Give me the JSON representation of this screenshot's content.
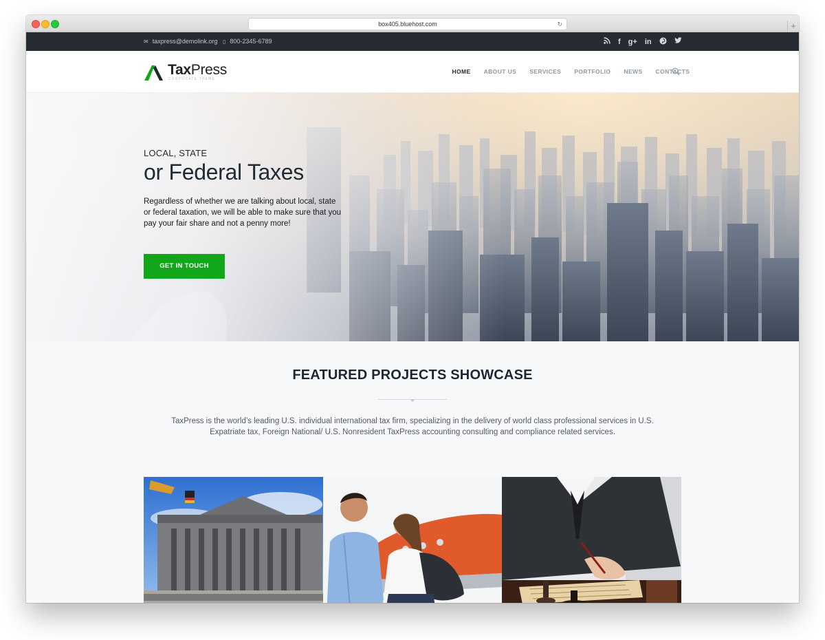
{
  "browser": {
    "url": "box405.bluehost.com"
  },
  "topbar": {
    "email": "taxpress@demolink.org",
    "phone": "800-2345-6789",
    "socials": [
      {
        "icon": "rss-icon",
        "glyph": "◔"
      },
      {
        "icon": "facebook-icon",
        "glyph": "f"
      },
      {
        "icon": "google-plus-icon",
        "glyph": "g+"
      },
      {
        "icon": "linkedin-icon",
        "glyph": "in"
      },
      {
        "icon": "pinterest-icon",
        "glyph": "℗"
      },
      {
        "icon": "twitter-icon",
        "glyph": "🐦"
      }
    ]
  },
  "header": {
    "logo_text_bold": "Tax",
    "logo_text_light": "Press",
    "logo_sub": "Corporate theme",
    "brand_color": "#12a71a",
    "nav": [
      "HOME",
      "ABOUT US",
      "SERVICES",
      "PORTFOLIO",
      "NEWS",
      "CONTACTS"
    ]
  },
  "hero": {
    "kicker": "LOCAL, STATE",
    "title": "or Federal Taxes",
    "text": "Regardless of whether we are talking about local, state or federal taxation, we will be able to make sure that you pay your fair share and not a penny more!",
    "button": "GET IN TOUCH"
  },
  "featured": {
    "title": "FEATURED PROJECTS SHOWCASE",
    "text": "TaxPress is the world’s leading U.S. individual international tax firm, specializing in the delivery of world class professional services in U.S. Expatriate tax, Foreign National/ U.S. Nonresident TaxPress accounting consulting and compliance related services."
  }
}
